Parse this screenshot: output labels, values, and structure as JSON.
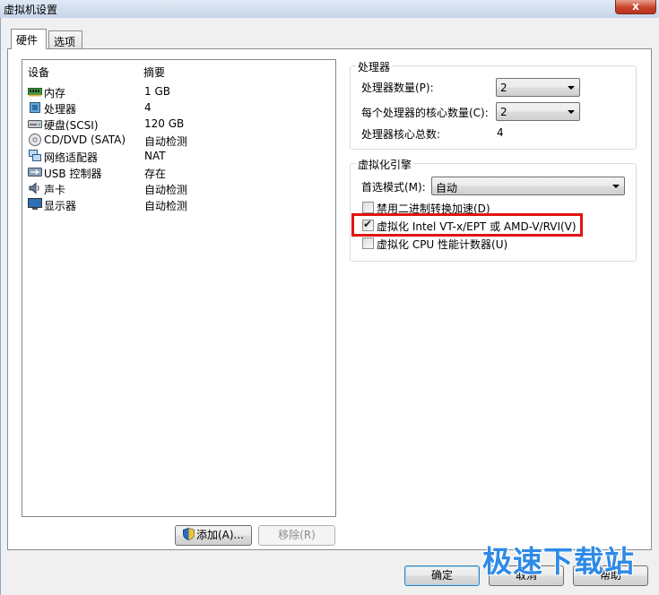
{
  "window": {
    "title": "虚拟机设置",
    "close_glyph": "x"
  },
  "tabs": [
    {
      "label": "硬件"
    },
    {
      "label": "选项"
    }
  ],
  "device_list": {
    "headers": {
      "device": "设备",
      "summary": "摘要"
    },
    "rows": [
      {
        "icon": "memory-icon",
        "name": "内存",
        "summary": "1 GB"
      },
      {
        "icon": "processor-icon",
        "name": "处理器",
        "summary": "4"
      },
      {
        "icon": "hard-disk-icon",
        "name": "硬盘(SCSI)",
        "summary": "120 GB"
      },
      {
        "icon": "cd-dvd-icon",
        "name": "CD/DVD (SATA)",
        "summary": "自动检测"
      },
      {
        "icon": "network-adapter-icon",
        "name": "网络适配器",
        "summary": "NAT"
      },
      {
        "icon": "usb-icon",
        "name": "USB 控制器",
        "summary": "存在"
      },
      {
        "icon": "sound-card-icon",
        "name": "声卡",
        "summary": "自动检测"
      },
      {
        "icon": "display-icon",
        "name": "显示器",
        "summary": "自动检测"
      }
    ],
    "selected_index": 1
  },
  "list_buttons": {
    "add": "添加(A)...",
    "remove": "移除(R)"
  },
  "processor": {
    "title": "处理器",
    "count_label": "处理器数量(P):",
    "count_value": "2",
    "cores_label": "每个处理器的核心数量(C):",
    "cores_value": "2",
    "total_label": "处理器核心总数:",
    "total_value": "4"
  },
  "virtualization": {
    "title": "虚拟化引擎",
    "mode_label": "首选模式(M):",
    "mode_value": "自动",
    "options": [
      {
        "label": "禁用二进制转换加速(D)",
        "checked": false
      },
      {
        "label": "虚拟化 Intel VT-x/EPT 或 AMD-V/RVI(V)",
        "checked": true
      },
      {
        "label": "虚拟化 CPU 性能计数器(U)",
        "checked": false
      }
    ]
  },
  "dialog_buttons": {
    "ok": "确定",
    "cancel": "取消",
    "help": "帮助"
  },
  "watermark": "极速下载站",
  "colors": {
    "highlight": "#e1140f",
    "watermark": "#2e8ae6"
  }
}
